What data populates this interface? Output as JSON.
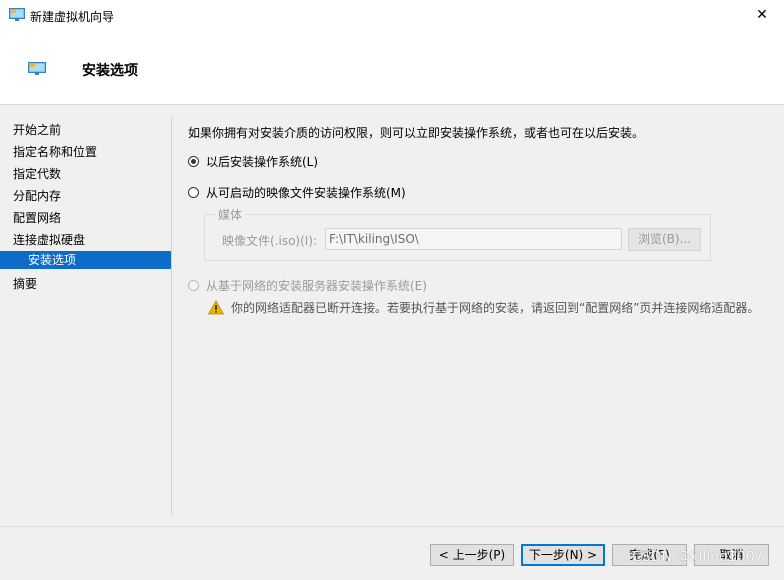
{
  "window": {
    "title": "新建虚拟机向导",
    "close_glyph": "✕",
    "app_icon": "monitor-icon"
  },
  "header": {
    "title": "安装选项",
    "icon": "monitor-icon"
  },
  "sidebar": {
    "items": [
      {
        "label": "开始之前",
        "active": false
      },
      {
        "label": "指定名称和位置",
        "active": false
      },
      {
        "label": "指定代数",
        "active": false
      },
      {
        "label": "分配内存",
        "active": false
      },
      {
        "label": "配置网络",
        "active": false
      },
      {
        "label": "连接虚拟硬盘",
        "active": false
      },
      {
        "label": "安装选项",
        "active": true
      },
      {
        "label": "摘要",
        "active": false
      }
    ]
  },
  "main": {
    "intro": "如果你拥有对安装介质的访问权限，则可以立即安装操作系统，或者也可在以后安装。",
    "option_later": {
      "label": "以后安装操作系统(L)",
      "checked": true
    },
    "option_image": {
      "label": "从可启动的映像文件安装操作系统(M)",
      "checked": false
    },
    "media": {
      "legend": "媒体",
      "label": "映像文件(.iso)(I):",
      "value": "F:\\IT\\kiling\\ISO\\",
      "browse": "浏览(B)..."
    },
    "option_network": {
      "label": "从基于网络的安装服务器安装操作系统(E)",
      "checked": false,
      "enabled": false
    },
    "warning": "你的网络适配器已断开连接。若要执行基于网络的安装，请返回到“配置网络”页并连接网络适配器。"
  },
  "footer": {
    "prev": "< 上一步(P)",
    "next": "下一步(N) >",
    "finish": "完成(F)",
    "cancel": "取消"
  },
  "watermark": "CSDN @kiling1007",
  "colors": {
    "accent": "#0c6cc7",
    "background": "#f0f0f0",
    "warning": "#f0b400"
  }
}
